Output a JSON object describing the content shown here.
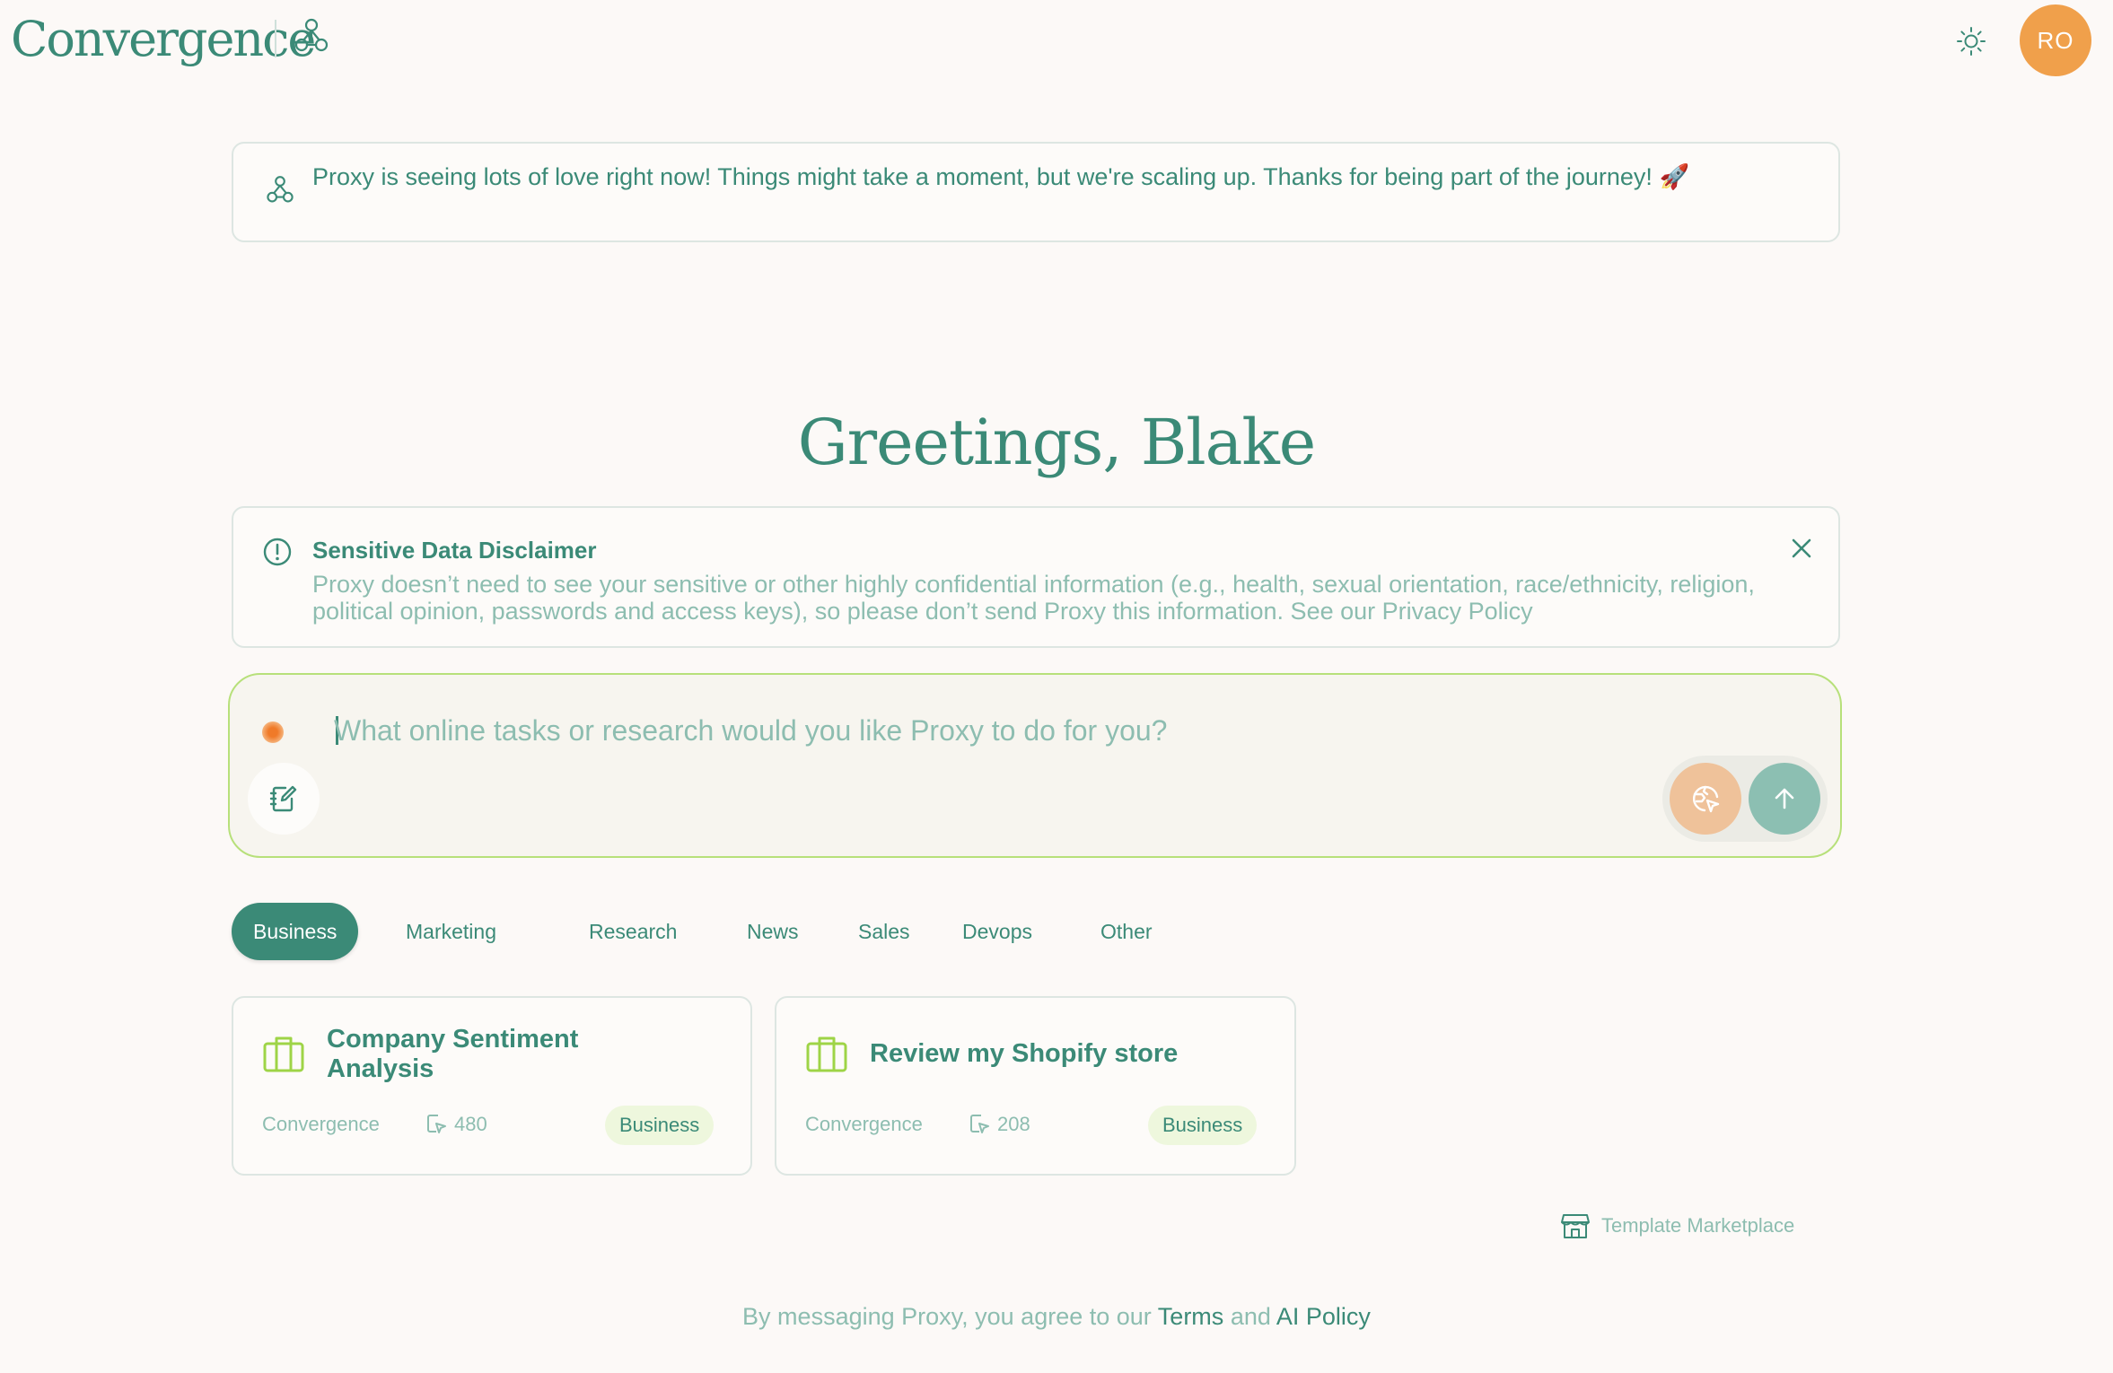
{
  "header": {
    "brand": "Convergence",
    "avatar_initials": "RO"
  },
  "announcement": {
    "text": "Proxy is seeing lots of love right now! Things might take a moment, but we're scaling up. Thanks for being part of the journey! 🚀"
  },
  "greeting": "Greetings, Blake",
  "disclaimer": {
    "title": "Sensitive Data Disclaimer",
    "body": "Proxy doesn’t need to see your sensitive or other highly confidential information (e.g., health, sexual orientation, race/ethnicity, religion, political opinion, passwords and access keys), so please don’t send Proxy this information. See our Privacy Policy"
  },
  "prompt": {
    "placeholder": "What online tasks or research would you like Proxy to do for you?",
    "value": ""
  },
  "tabs": [
    {
      "label": "Business",
      "active": true
    },
    {
      "label": "Marketing",
      "active": false
    },
    {
      "label": "Research",
      "active": false
    },
    {
      "label": "News",
      "active": false
    },
    {
      "label": "Sales",
      "active": false
    },
    {
      "label": "Devops",
      "active": false
    },
    {
      "label": "Other",
      "active": false
    }
  ],
  "cards": [
    {
      "title": "Company Sentiment Analysis",
      "author": "Convergence",
      "uses": "480",
      "category": "Business"
    },
    {
      "title": "Review my Shopify store",
      "author": "Convergence",
      "uses": "208",
      "category": "Business"
    }
  ],
  "marketplace": {
    "label": "Template Marketplace"
  },
  "footer": {
    "prefix": "By messaging Proxy, you agree to our",
    "terms": "Terms",
    "and": "and",
    "policy": "AI Policy"
  },
  "colors": {
    "accent": "#3b8a77",
    "muted": "#8dbdb0",
    "avatar": "#f0a04b",
    "prompt_border": "#b7e07a",
    "badge_bg": "#eef7dd"
  }
}
